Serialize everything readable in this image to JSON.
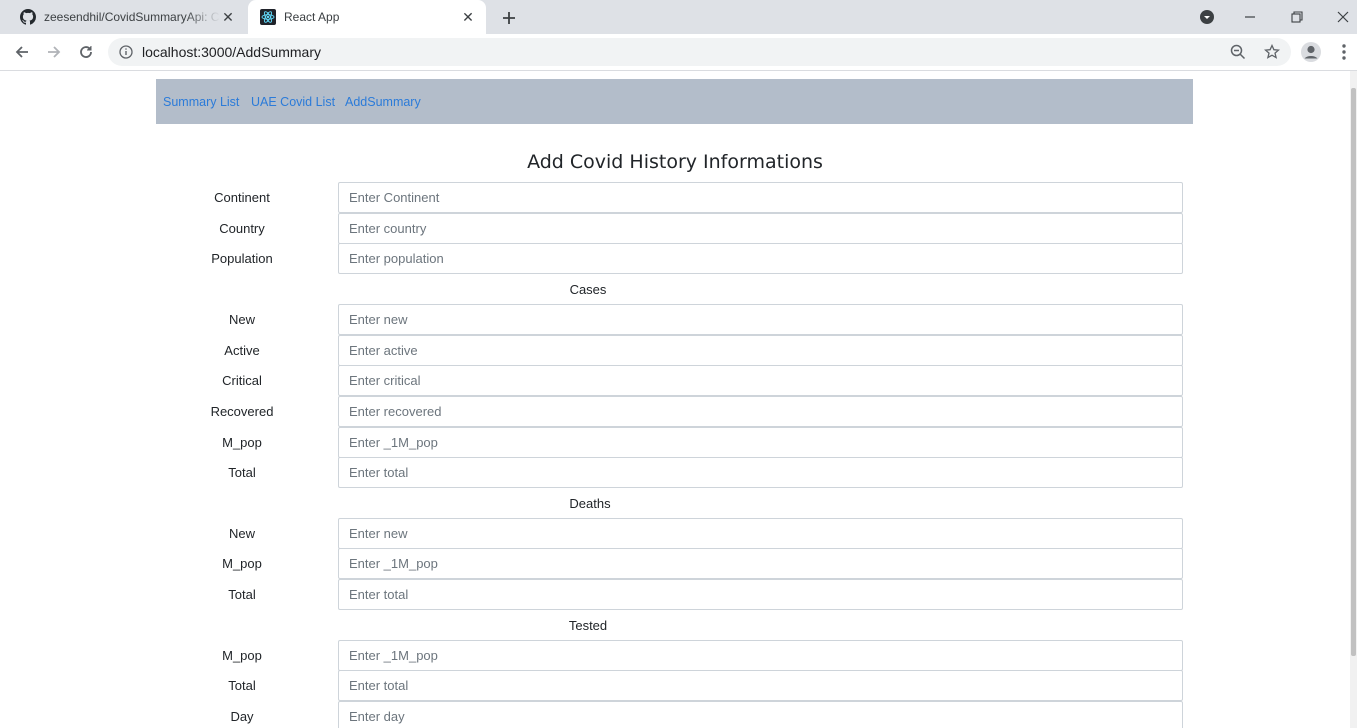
{
  "browser": {
    "tabs": [
      {
        "title": "zeesendhil/CovidSummaryApi: Covid",
        "icon": "github-icon"
      },
      {
        "title": "React App",
        "icon": "react-icon"
      }
    ],
    "url": "localhost:3000/AddSummary"
  },
  "nav": {
    "links": [
      "Summary List",
      "UAE Covid List",
      "AddSummary"
    ]
  },
  "page": {
    "heading": "Add Covid History Informations"
  },
  "form": {
    "fields": [
      {
        "label": "Continent",
        "placeholder": "Enter Continent"
      },
      {
        "label": "Country",
        "placeholder": "Enter country"
      },
      {
        "label": "Population",
        "placeholder": "Enter population"
      }
    ],
    "cases": {
      "title": "Cases",
      "fields": [
        {
          "label": "New",
          "placeholder": "Enter new"
        },
        {
          "label": "Active",
          "placeholder": "Enter active"
        },
        {
          "label": "Critical",
          "placeholder": "Enter critical"
        },
        {
          "label": "Recovered",
          "placeholder": "Enter recovered"
        },
        {
          "label": "M_pop",
          "placeholder": "Enter _1M_pop"
        },
        {
          "label": "Total",
          "placeholder": "Enter total"
        }
      ]
    },
    "deaths": {
      "title": "Deaths",
      "fields": [
        {
          "label": "New",
          "placeholder": "Enter new"
        },
        {
          "label": "M_pop",
          "placeholder": "Enter _1M_pop"
        },
        {
          "label": "Total",
          "placeholder": "Enter total"
        }
      ]
    },
    "tested": {
      "title": "Tested",
      "fields": [
        {
          "label": "M_pop",
          "placeholder": "Enter _1M_pop"
        },
        {
          "label": "Total",
          "placeholder": "Enter total"
        },
        {
          "label": "Day",
          "placeholder": "Enter day"
        }
      ]
    }
  }
}
